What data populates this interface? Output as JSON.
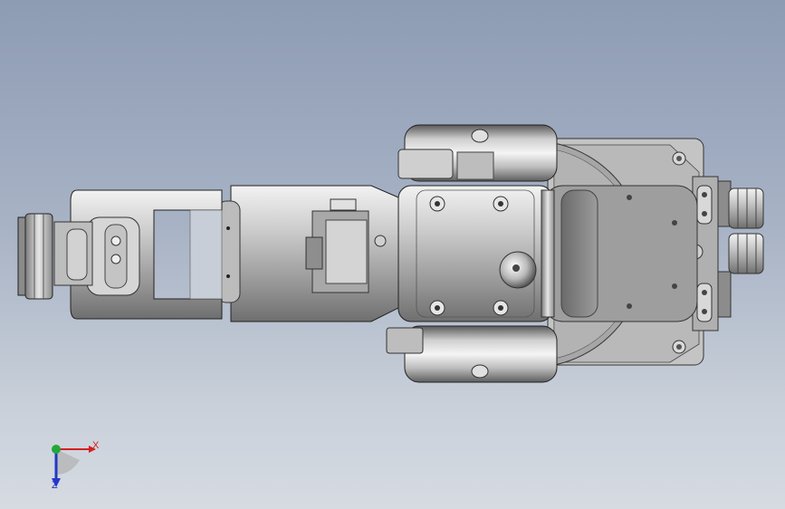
{
  "viewport": {
    "background_top": "#8d9bb4",
    "background_bottom": "#d6dbe2",
    "content": "robot-arm-top-view"
  },
  "triad": {
    "x_label": "X",
    "z_label": "Z",
    "x_color": "#d42020",
    "y_color": "#22a83a",
    "z_color": "#2238c8"
  }
}
